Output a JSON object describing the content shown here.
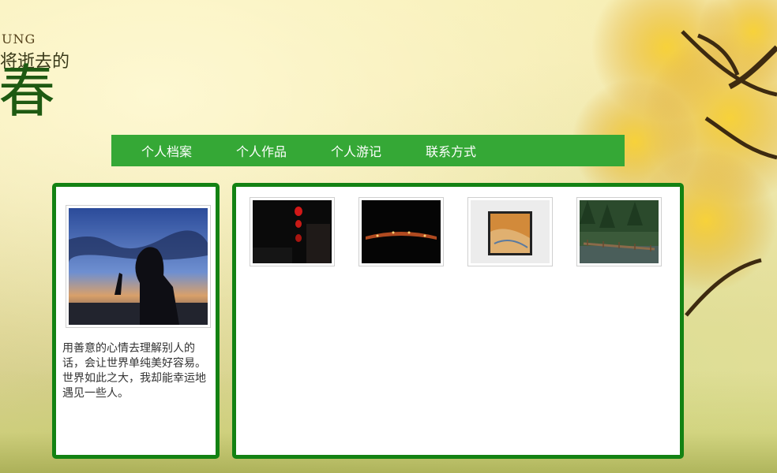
{
  "header": {
    "title_small": "UNG",
    "title_mid": "将逝去的",
    "title_big": "春"
  },
  "nav": {
    "items": [
      {
        "label": "个人档案"
      },
      {
        "label": "个人作品"
      },
      {
        "label": "个人游记"
      },
      {
        "label": "联系方式"
      }
    ]
  },
  "profile": {
    "photo_icon": "silhouette-sunset-photo",
    "bio": "用善意的心情去理解别人的话，会让世界单纯美好容易。世界如此之大，我却能幸运地遇见一些人。"
  },
  "gallery": {
    "items": [
      {
        "name": "red-lanterns-night-photo"
      },
      {
        "name": "night-bridge-lights-photo"
      },
      {
        "name": "framed-painting-photo"
      },
      {
        "name": "wooden-boardwalk-forest-photo"
      }
    ]
  },
  "colors": {
    "nav_bg": "#35a836",
    "panel_border": "#138213"
  }
}
